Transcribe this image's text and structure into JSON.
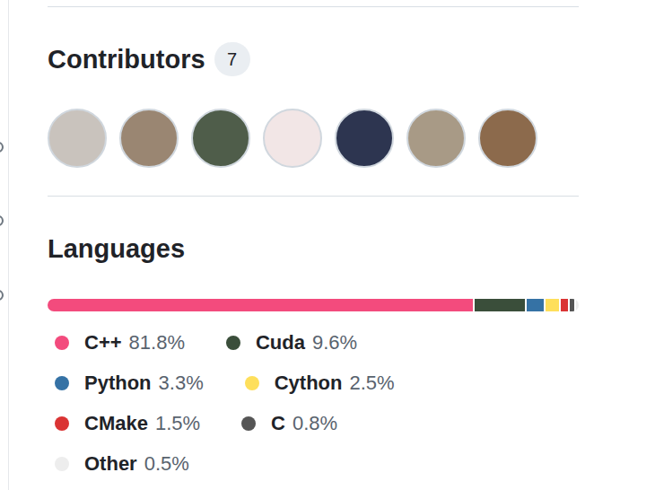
{
  "contributors": {
    "title": "Contributors",
    "count": "7",
    "avatars": [
      {
        "color": "#c9c3bd"
      },
      {
        "color": "#9a8672"
      },
      {
        "color": "#4f5d4a"
      },
      {
        "color": "#f2e6e6"
      },
      {
        "color": "#2d3550"
      },
      {
        "color": "#a89a86"
      },
      {
        "color": "#8c6a4c"
      }
    ]
  },
  "languages": {
    "title": "Languages",
    "items": [
      {
        "name": "C++",
        "percent": "81.8%",
        "level": 0.818,
        "color": "#f34b7d"
      },
      {
        "name": "Cuda",
        "percent": "9.6%",
        "level": 0.096,
        "color": "#3a4e3a"
      },
      {
        "name": "Python",
        "percent": "3.3%",
        "level": 0.033,
        "color": "#3572a5"
      },
      {
        "name": "Cython",
        "percent": "2.5%",
        "level": 0.025,
        "color": "#fedf5b"
      },
      {
        "name": "CMake",
        "percent": "1.5%",
        "level": 0.015,
        "color": "#da3434"
      },
      {
        "name": "C",
        "percent": "0.8%",
        "level": 0.008,
        "color": "#555555"
      },
      {
        "name": "Other",
        "percent": "0.5%",
        "level": 0.005,
        "color": "#ededed"
      }
    ]
  }
}
